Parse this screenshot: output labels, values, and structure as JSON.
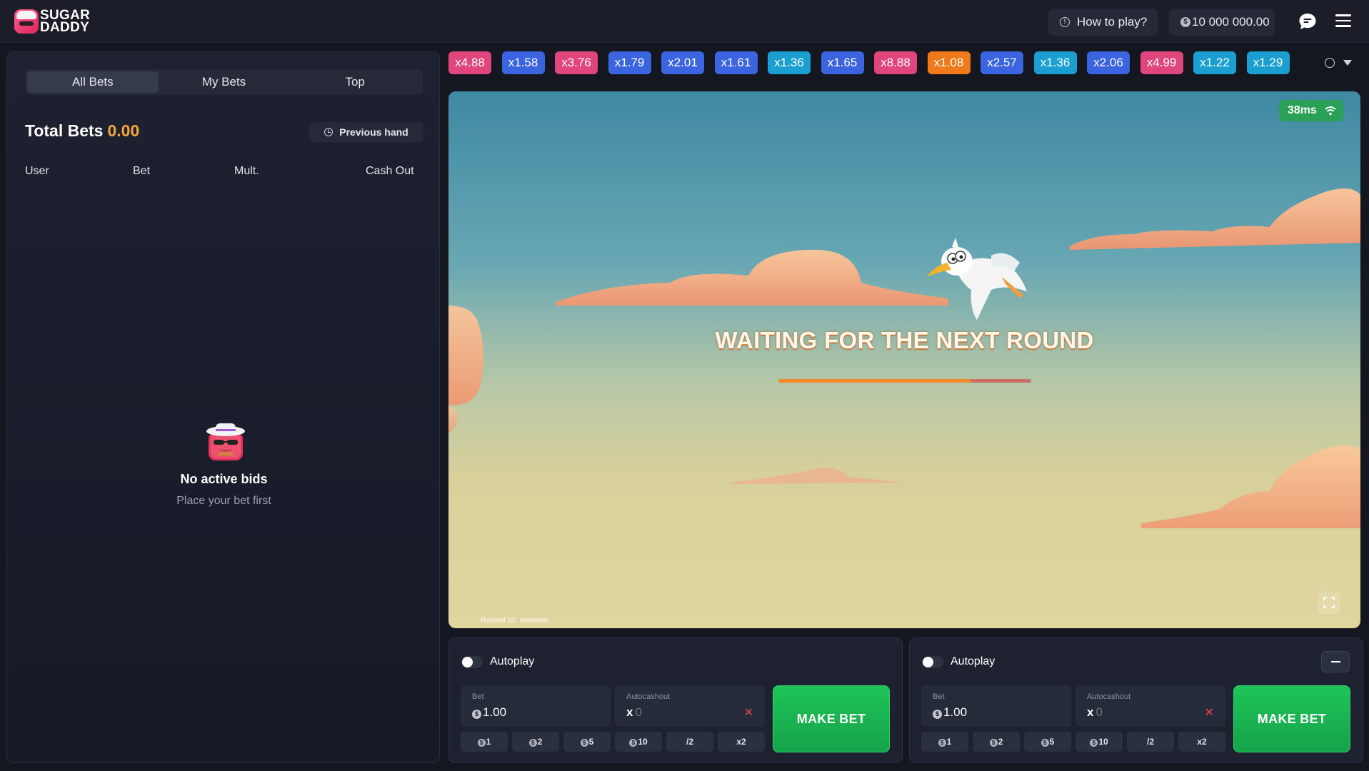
{
  "header": {
    "logo_line1": "SUGAR",
    "logo_line2": "DADDY",
    "how_to_play": "How to play?",
    "balance": "10 000 000.00"
  },
  "left_panel": {
    "tabs": [
      {
        "label": "All Bets",
        "active": true
      },
      {
        "label": "My Bets",
        "active": false
      },
      {
        "label": "Top",
        "active": false
      }
    ],
    "total_label": "Total Bets",
    "total_value": "0.00",
    "previous_hand": "Previous hand",
    "columns": [
      "User",
      "Bet",
      "Mult.",
      "Cash Out"
    ],
    "empty_title": "No active bids",
    "empty_subtitle": "Place your bet first"
  },
  "history": [
    {
      "label": "x4.88",
      "color": "#e0457b"
    },
    {
      "label": "x1.58",
      "color": "#3b64e0"
    },
    {
      "label": "x3.76",
      "color": "#e0457b"
    },
    {
      "label": "x1.79",
      "color": "#3b64e0"
    },
    {
      "label": "x2.01",
      "color": "#3b64e0"
    },
    {
      "label": "x1.61",
      "color": "#3b64e0"
    },
    {
      "label": "x1.36",
      "color": "#1b9fd0"
    },
    {
      "label": "x1.65",
      "color": "#3b64e0"
    },
    {
      "label": "x8.88",
      "color": "#e0457b"
    },
    {
      "label": "x1.08",
      "color": "#f07a1a"
    },
    {
      "label": "x2.57",
      "color": "#3b64e0"
    },
    {
      "label": "x1.36",
      "color": "#1b9fd0"
    },
    {
      "label": "x2.06",
      "color": "#3b64e0"
    },
    {
      "label": "x4.99",
      "color": "#e0457b"
    },
    {
      "label": "x1.22",
      "color": "#1b9fd0"
    },
    {
      "label": "x1.29",
      "color": "#1b9fd0"
    }
  ],
  "game": {
    "ping": "38ms",
    "status": "WAITING FOR THE NEXT ROUND",
    "progress": 0.76,
    "round_id_label": "Round id:"
  },
  "bet_panels": [
    {
      "autoplay_label": "Autoplay",
      "bet_label": "Bet",
      "bet_value": "1.00",
      "autocashout_label": "Autocashout",
      "autocashout_prefix": "x",
      "autocashout_value": "0",
      "chips": [
        "1",
        "2",
        "5",
        "10",
        "/2",
        "x2"
      ],
      "make_bet": "MAKE BET"
    },
    {
      "autoplay_label": "Autoplay",
      "bet_label": "Bet",
      "bet_value": "1.00",
      "autocashout_label": "Autocashout",
      "autocashout_prefix": "x",
      "autocashout_value": "0",
      "chips": [
        "1",
        "2",
        "5",
        "10",
        "/2",
        "x2"
      ],
      "make_bet": "MAKE BET"
    }
  ],
  "colors": {
    "accent_orange": "#f7a53c",
    "make_bet_green": "#16a34a",
    "ping_green": "#2aa157"
  }
}
